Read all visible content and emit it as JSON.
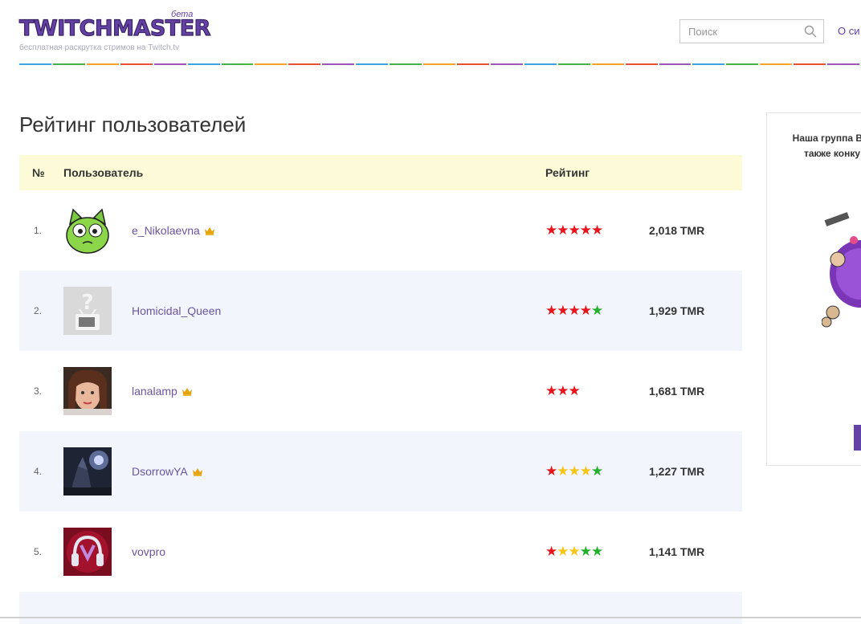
{
  "header": {
    "logo_text": "twitchmaster",
    "logo_beta": "бета",
    "logo_subtitle": "бесплатная раскрутка стримов на Twitch.tv",
    "search_placeholder": "Поиск",
    "nav_link": "О си",
    "rainbow_colors": [
      "#3ba4e0",
      "#48b04c",
      "#f6a623",
      "#e94e3c",
      "#9b59b6",
      "#3ba4e0",
      "#48b04c",
      "#f6a623",
      "#e94e3c",
      "#9b59b6",
      "#3ba4e0",
      "#48b04c",
      "#f6a623",
      "#e94e3c",
      "#9b59b6",
      "#3ba4e0",
      "#48b04c",
      "#f6a623",
      "#e94e3c",
      "#9b59b6",
      "#3ba4e0",
      "#48b04c",
      "#f6a623",
      "#e94e3c",
      "#9b59b6"
    ]
  },
  "page_title": "Рейтинг пользователей",
  "table": {
    "col_num": "№",
    "col_user": "Пользователь",
    "col_rating": "Рейтинг",
    "rows": [
      {
        "num": "1.",
        "name": "e_Nikolaevna",
        "crown": true,
        "stars": "rrrrr",
        "score": "2,018 TMR",
        "avatar": "green-cat"
      },
      {
        "num": "2.",
        "name": "Homicidal_Queen",
        "crown": false,
        "stars": "rrrrg",
        "score": "1,929 TMR",
        "avatar": "placeholder"
      },
      {
        "num": "3.",
        "name": "lanalamp",
        "crown": true,
        "stars": "rrr",
        "score": "1,681 TMR",
        "avatar": "photo"
      },
      {
        "num": "4.",
        "name": "DsorrowYA",
        "crown": true,
        "stars": "ryyyg",
        "score": "1,227 TMR",
        "avatar": "game-art"
      },
      {
        "num": "5.",
        "name": "vovpro",
        "crown": false,
        "stars": "ryygg",
        "score": "1,141 TMR",
        "avatar": "headphones"
      }
    ]
  },
  "sidebar": {
    "text_line1": "Наша группа ВК:",
    "text_line2": "также конку"
  },
  "colors": {
    "brand": "#6441a4",
    "header_row": "#fdfbd7",
    "alt_row": "#f2f5fc",
    "star_red": "#e8141b",
    "star_yellow": "#f5c518",
    "star_green": "#23b02c",
    "crown": "#e5a50a"
  }
}
